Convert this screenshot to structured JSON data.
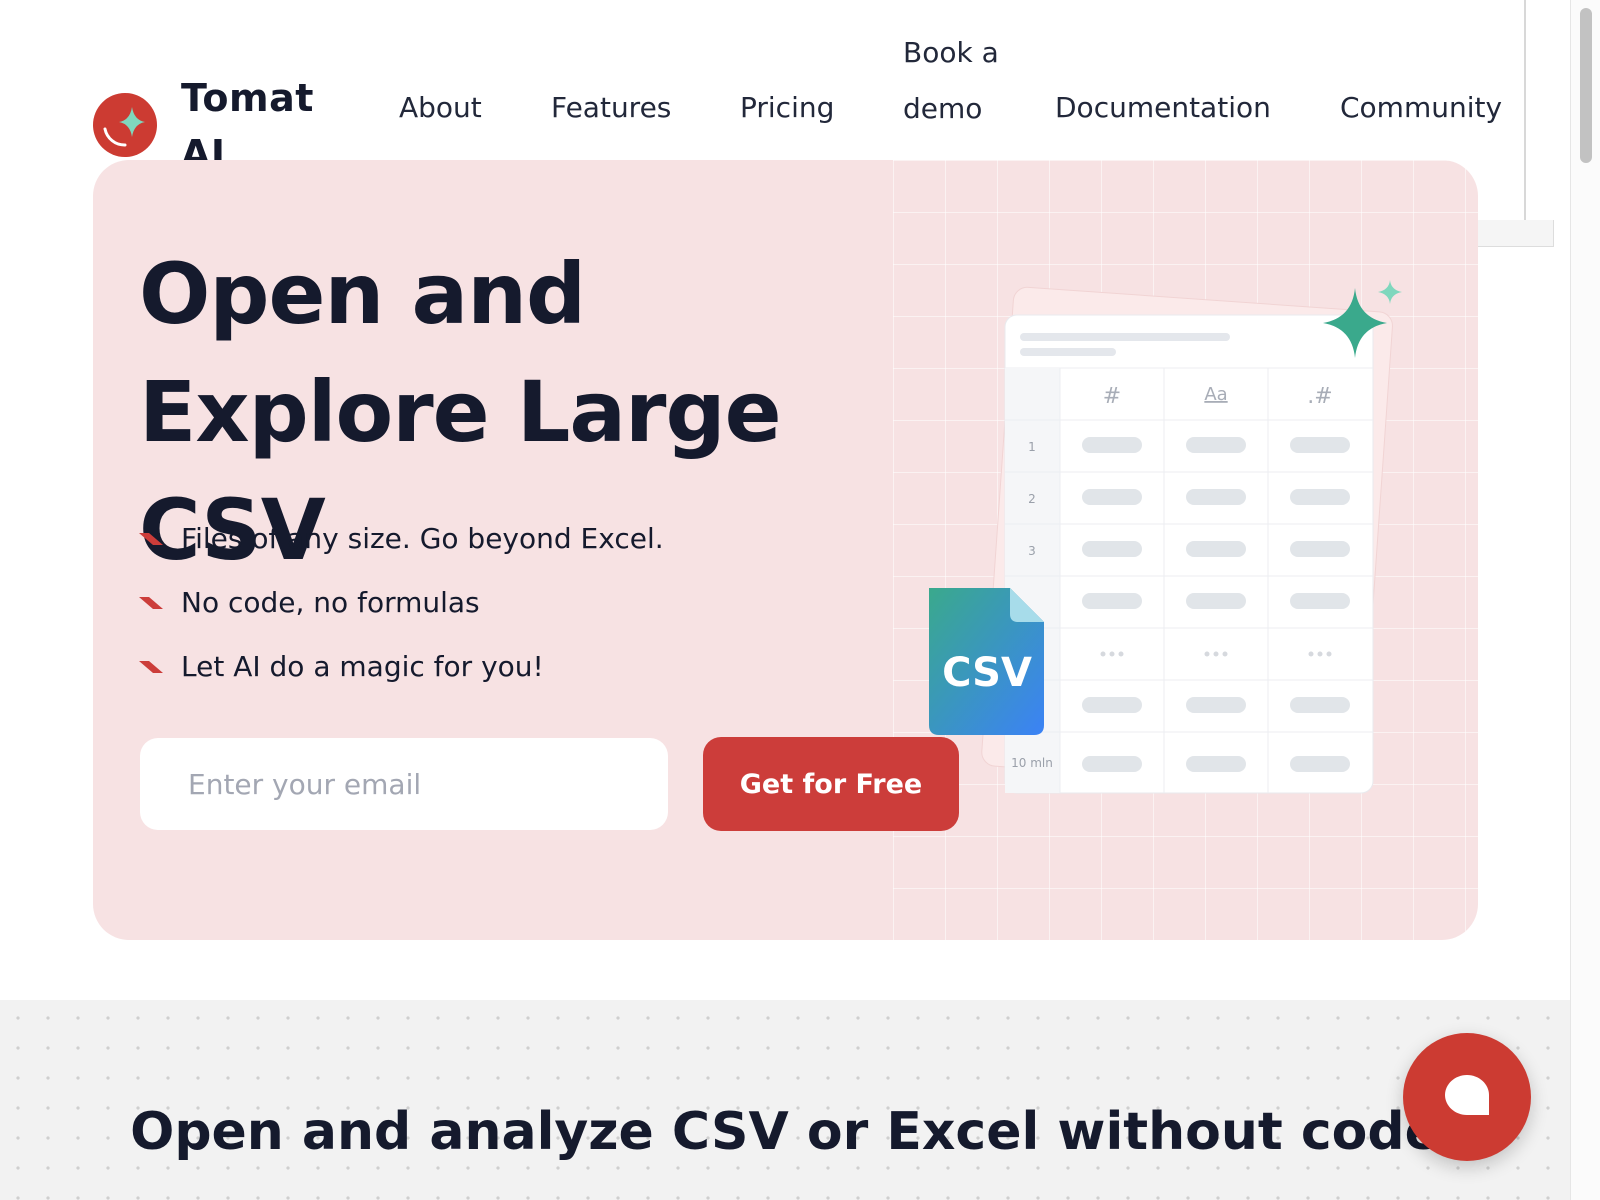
{
  "brand": {
    "name": "Tomat AI"
  },
  "nav": {
    "items": [
      {
        "label": "About"
      },
      {
        "label": "Features"
      },
      {
        "label": "Pricing"
      },
      {
        "label": "Book a demo"
      },
      {
        "label": "Documentation"
      },
      {
        "label": "Community"
      }
    ]
  },
  "hero": {
    "title": "Open and Explore Large CSV",
    "bullets": [
      "Files of any size. Go beyond Excel.",
      "No code, no formulas",
      "Let AI do a magic for you!"
    ],
    "email_placeholder": "Enter your email",
    "cta_label": "Get for Free"
  },
  "illustration": {
    "col_headers": [
      "#",
      "Aa",
      ".#"
    ],
    "row_numbers": [
      "1",
      "2",
      "3"
    ],
    "last_row_label": "10 mln",
    "file_badge": "CSV"
  },
  "section2": {
    "title": "Open and analyze CSV or Excel without code"
  },
  "colors": {
    "accent": "#cc3d3a",
    "hero_bg": "#f7e2e3",
    "teal": "#3aa98c"
  }
}
